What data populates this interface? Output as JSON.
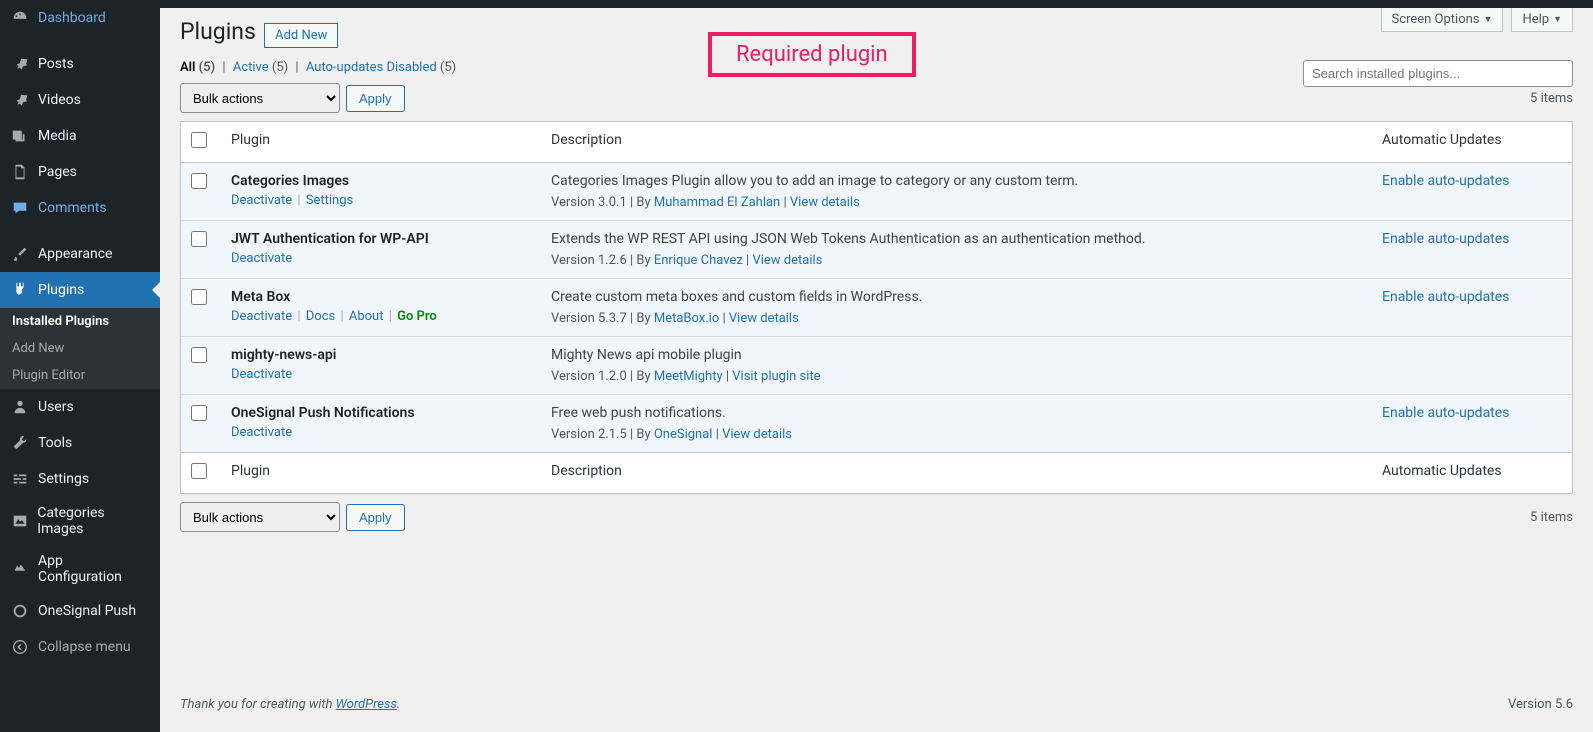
{
  "screen_options": "Screen Options",
  "help": "Help",
  "sidebar": {
    "dashboard": "Dashboard",
    "posts": "Posts",
    "videos": "Videos",
    "media": "Media",
    "pages": "Pages",
    "comments": "Comments",
    "appearance": "Appearance",
    "plugins": "Plugins",
    "installed": "Installed Plugins",
    "add_new": "Add New",
    "plugin_editor": "Plugin Editor",
    "users": "Users",
    "tools": "Tools",
    "settings": "Settings",
    "cat_images": "Categories Images",
    "app_config": "App Configuration",
    "onesignal": "OneSignal Push",
    "collapse": "Collapse menu"
  },
  "page": {
    "title": "Plugins",
    "add_new": "Add New"
  },
  "callout": "Required plugin",
  "filters": {
    "all": "All",
    "all_cnt": "(5)",
    "active": "Active",
    "active_cnt": "(5)",
    "auto_dis": "Auto-updates Disabled",
    "auto_dis_cnt": "(5)"
  },
  "search_placeholder": "Search installed plugins...",
  "bulk": {
    "label": "Bulk actions",
    "apply": "Apply"
  },
  "items_count_top": "5 items",
  "items_count_bottom": "5 items",
  "cols": {
    "plugin": "Plugin",
    "desc": "Description",
    "auto": "Automatic Updates"
  },
  "rows": [
    {
      "name": "Categories Images",
      "actions": [
        {
          "t": "Deactivate"
        },
        {
          "t": "Settings"
        }
      ],
      "desc": "Categories Images Plugin allow you to add an image to category or any custom term.",
      "meta_pre": "Version 3.0.1 | By ",
      "author": "Muhammad El Zahlan",
      "meta_post": " | ",
      "detail": "View details",
      "auto": "Enable auto-updates"
    },
    {
      "name": "JWT Authentication for WP-API",
      "actions": [
        {
          "t": "Deactivate"
        }
      ],
      "desc": "Extends the WP REST API using JSON Web Tokens Authentication as an authentication method.",
      "meta_pre": "Version 1.2.6 | By ",
      "author": "Enrique Chavez",
      "meta_post": " | ",
      "detail": "View details",
      "auto": "Enable auto-updates"
    },
    {
      "name": "Meta Box",
      "actions": [
        {
          "t": "Deactivate"
        },
        {
          "t": "Docs"
        },
        {
          "t": "About"
        },
        {
          "t": "Go Pro",
          "go": true
        }
      ],
      "desc": "Create custom meta boxes and custom fields in WordPress.",
      "meta_pre": "Version 5.3.7 | By ",
      "author": "MetaBox.io",
      "meta_post": " | ",
      "detail": "View details",
      "auto": "Enable auto-updates"
    },
    {
      "name": "mighty-news-api",
      "actions": [
        {
          "t": "Deactivate"
        }
      ],
      "desc": "Mighty News api mobile plugin",
      "meta_pre": "Version 1.2.0 | By ",
      "author": "MeetMighty",
      "meta_post": " | ",
      "detail": "Visit plugin site",
      "auto": ""
    },
    {
      "name": "OneSignal Push Notifications",
      "actions": [
        {
          "t": "Deactivate"
        }
      ],
      "desc": "Free web push notifications.",
      "meta_pre": "Version 2.1.5 | By ",
      "author": "OneSignal",
      "meta_post": " | ",
      "detail": "View details",
      "auto": "Enable auto-updates"
    }
  ],
  "footer": {
    "text": "Thank you for creating with ",
    "link": "WordPress",
    "version": "Version 5.6"
  }
}
